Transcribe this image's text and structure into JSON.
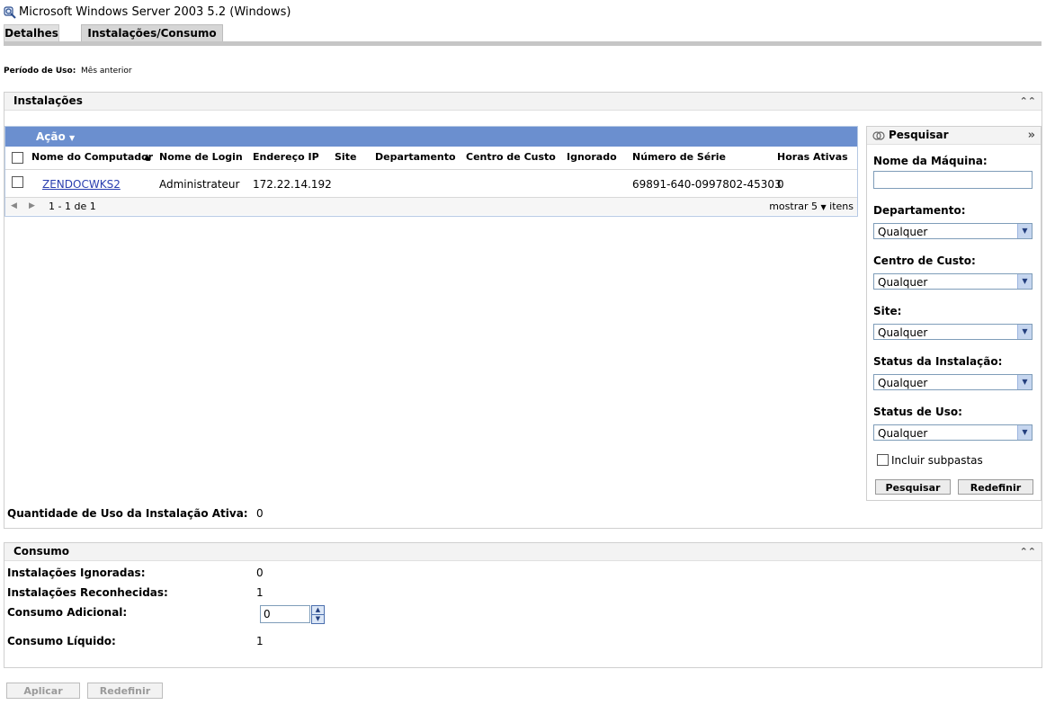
{
  "window": {
    "title": "Microsoft Windows Server 2003 5.2 (Windows)"
  },
  "tabs": [
    {
      "label": "Detalhes"
    },
    {
      "label": "Instalações/Consumo"
    }
  ],
  "period": {
    "label": "Período de Uso:",
    "value": "Mês anterior"
  },
  "installations": {
    "title": "Instalações",
    "action_label": "Ação",
    "columns": [
      "Nome do Computador",
      "Nome de Login",
      "Endereço IP",
      "Site",
      "Departamento",
      "Centro de Custo",
      "Ignorado",
      "Número de Série",
      "Horas Ativas"
    ],
    "rows": [
      {
        "computer": "ZENDOCWKS2",
        "login": "Administrateur",
        "ip": "172.22.14.192",
        "site": "",
        "department": "",
        "cost_center": "",
        "ignored": "",
        "serial": "69891-640-0997802-45303",
        "hours": "0"
      }
    ],
    "pager": {
      "range": "1 - 1 de 1",
      "show_label": "mostrar",
      "page_size": "5",
      "items_label": "itens"
    },
    "active_usage_label": "Quantidade de Uso da Instalação Ativa:",
    "active_usage_value": "0"
  },
  "search": {
    "title": "Pesquisar",
    "machine_name_label": "Nome da Máquina:",
    "machine_name_value": "",
    "department_label": "Departamento:",
    "department_value": "Qualquer",
    "cost_center_label": "Centro de Custo:",
    "cost_center_value": "Qualquer",
    "site_label": "Site:",
    "site_value": "Qualquer",
    "install_status_label": "Status da Instalação:",
    "install_status_value": "Qualquer",
    "usage_status_label": "Status de Uso:",
    "usage_status_value": "Qualquer",
    "include_subfolders_label": "Incluir subpastas",
    "search_button": "Pesquisar",
    "reset_button": "Redefinir"
  },
  "consumption": {
    "title": "Consumo",
    "ignored_label": "Instalações Ignoradas:",
    "ignored_value": "0",
    "recognized_label": "Instalações Reconhecidas:",
    "recognized_value": "1",
    "additional_label": "Consumo Adicional:",
    "additional_value": "0",
    "net_label": "Consumo Líquido:",
    "net_value": "1"
  },
  "footer": {
    "apply_button": "Aplicar",
    "reset_button": "Redefinir"
  }
}
